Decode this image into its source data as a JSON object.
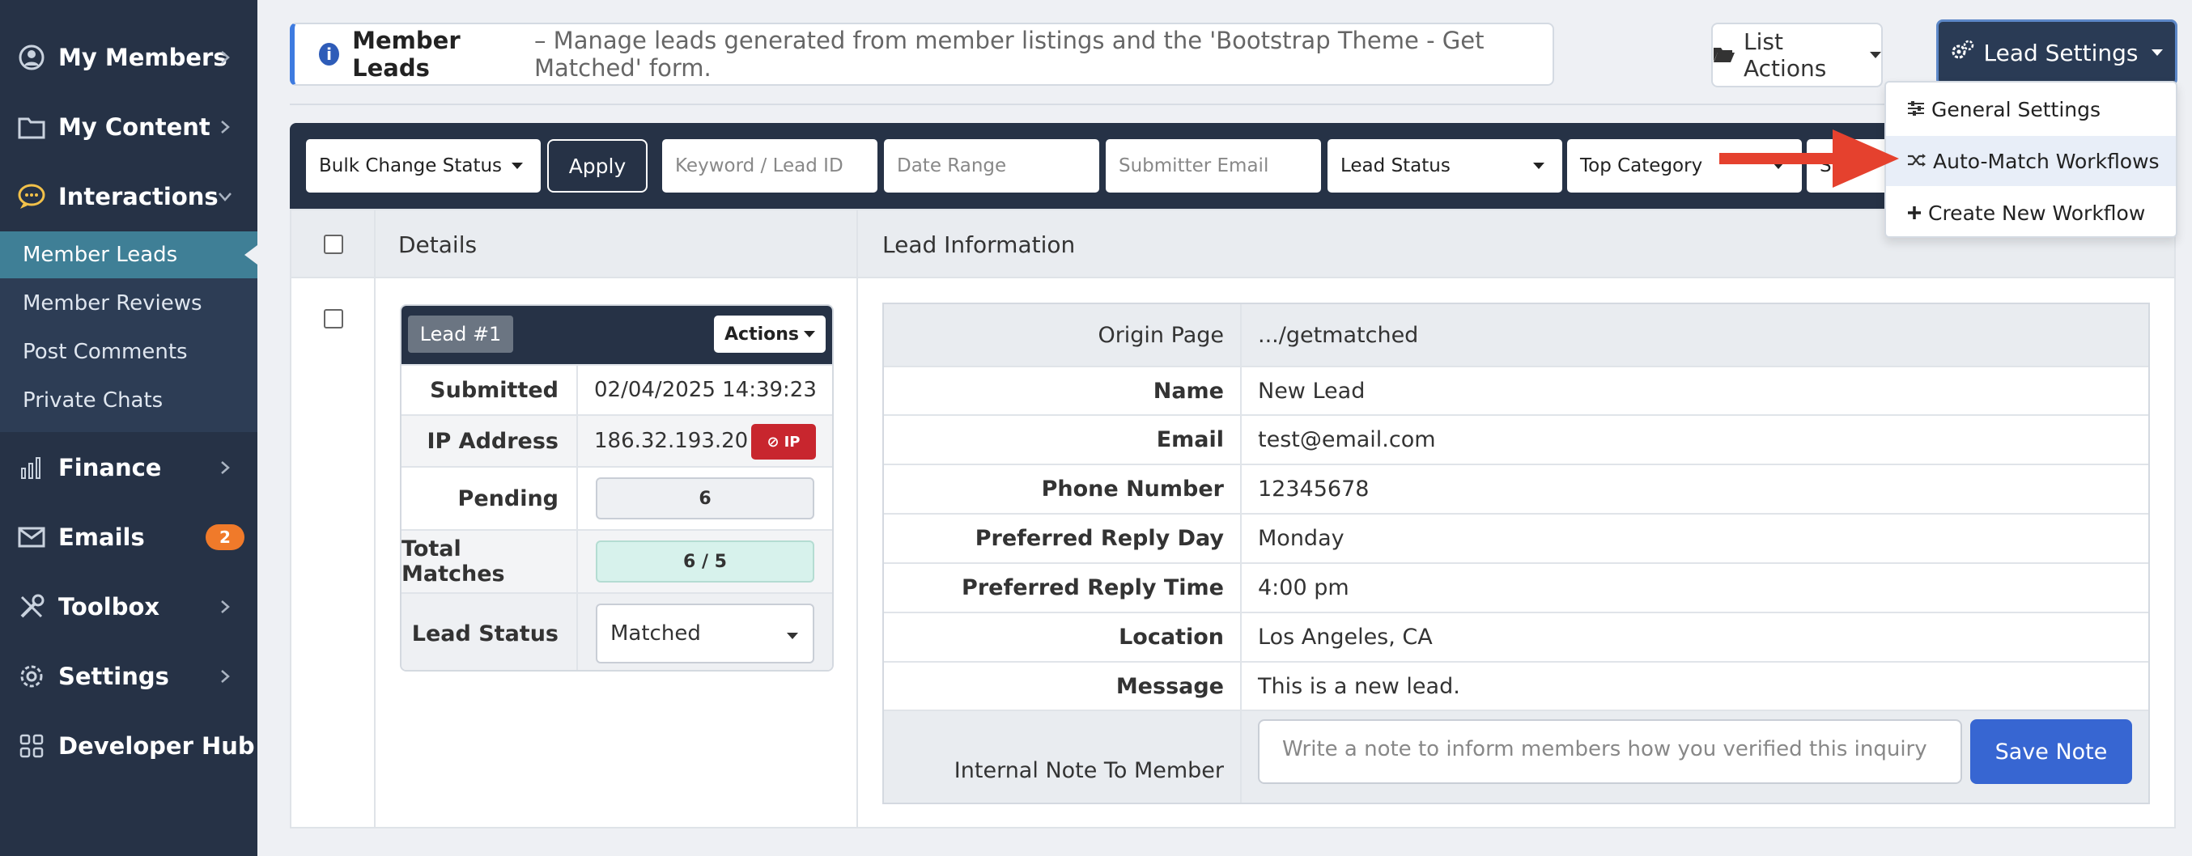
{
  "sidebar": {
    "items": [
      {
        "label": "My Members",
        "icon": "user-circle-icon"
      },
      {
        "label": "My Content",
        "icon": "folder-icon"
      },
      {
        "label": "Interactions",
        "icon": "chat-bubble-icon"
      },
      {
        "label": "Finance",
        "icon": "bar-chart-icon"
      },
      {
        "label": "Emails",
        "icon": "envelope-icon",
        "badge": "2"
      },
      {
        "label": "Toolbox",
        "icon": "tools-icon"
      },
      {
        "label": "Settings",
        "icon": "gear-icon"
      },
      {
        "label": "Developer Hub",
        "icon": "grid-icon"
      }
    ],
    "submenu": [
      "Member Leads",
      "Member Reviews",
      "Post Comments",
      "Private Chats"
    ]
  },
  "header": {
    "title": "Member Leads",
    "description": "– Manage leads generated from member listings and the 'Bootstrap Theme - Get Matched' form.",
    "list_actions": "List Actions",
    "lead_settings": "Lead Settings"
  },
  "dropdown": {
    "items": [
      "General Settings",
      "Auto-Match Workflows",
      "Create New Workflow"
    ]
  },
  "filters": {
    "bulk_change": "Bulk Change Status",
    "apply": "Apply",
    "keyword_ph": "Keyword / Lead ID",
    "date_ph": "Date Range",
    "email_ph": "Submitter Email",
    "lead_status": "Lead Status",
    "top_category": "Top Category",
    "truncated": "S"
  },
  "table": {
    "col_details": "Details",
    "col_info": "Lead Information"
  },
  "card": {
    "lead_no": "Lead #1",
    "actions": "Actions",
    "rows": {
      "submitted_k": "Submitted",
      "submitted_v": "02/04/2025 14:39:23",
      "ip_k": "IP Address",
      "ip_v": "186.32.193.20",
      "ip_btn": "IP",
      "pending_k": "Pending",
      "pending_v": "6",
      "matches_k": "Total Matches",
      "matches_v": "6 / 5",
      "status_k": "Lead Status",
      "status_v": "Matched"
    }
  },
  "lead_info": {
    "origin_k": "Origin Page",
    "origin_v": ".../getmatched",
    "name_k": "Name",
    "name_v": "New Lead",
    "email_k": "Email",
    "email_v": "test@email.com",
    "phone_k": "Phone Number",
    "phone_v": "12345678",
    "day_k": "Preferred Reply Day",
    "day_v": "Monday",
    "time_k": "Preferred Reply Time",
    "time_v": "4:00 pm",
    "loc_k": "Location",
    "loc_v": "Los Angeles, CA",
    "msg_k": "Message",
    "msg_v": "This is a new lead.",
    "note_k": "Internal Note To Member",
    "note_ph": "Write a note to inform members how you verified this inquiry",
    "save": "Save Note"
  },
  "colors": {
    "sidebar": "#263246",
    "active": "#3f7f96",
    "accent": "#3766d2",
    "arrow": "#e5412e"
  }
}
